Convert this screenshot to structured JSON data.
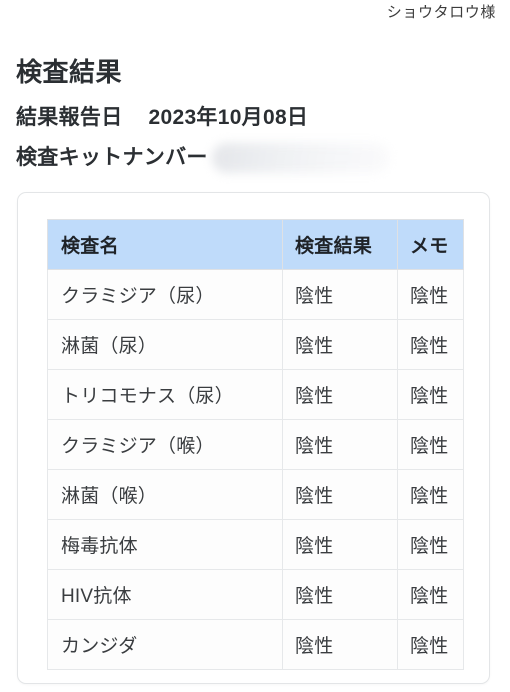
{
  "header": {
    "greeting": "ショウタロウ様",
    "title": "検査結果",
    "report_date_label": "結果報告日",
    "report_date_value": "2023年10月08日",
    "kit_number_label": "検査キットナンバー",
    "kit_number_value": ""
  },
  "table": {
    "columns": [
      "検査名",
      "検査結果",
      "メモ"
    ],
    "rows": [
      {
        "name": "クラミジア（尿）",
        "result": "陰性",
        "memo": "陰性"
      },
      {
        "name": "淋菌（尿）",
        "result": "陰性",
        "memo": "陰性"
      },
      {
        "name": "トリコモナス（尿）",
        "result": "陰性",
        "memo": "陰性"
      },
      {
        "name": "クラミジア（喉）",
        "result": "陰性",
        "memo": "陰性"
      },
      {
        "name": "淋菌（喉）",
        "result": "陰性",
        "memo": "陰性"
      },
      {
        "name": "梅毒抗体",
        "result": "陰性",
        "memo": "陰性"
      },
      {
        "name": "HIV抗体",
        "result": "陰性",
        "memo": "陰性"
      },
      {
        "name": "カンジダ",
        "result": "陰性",
        "memo": "陰性"
      }
    ]
  },
  "colors": {
    "header_blue": "#bfdbfa",
    "text_dark": "#2b2f33",
    "cell_text": "#3a3d40",
    "border": "#e6e8ea",
    "card_border": "#e3e5e7",
    "page_background": "#ffffff"
  }
}
